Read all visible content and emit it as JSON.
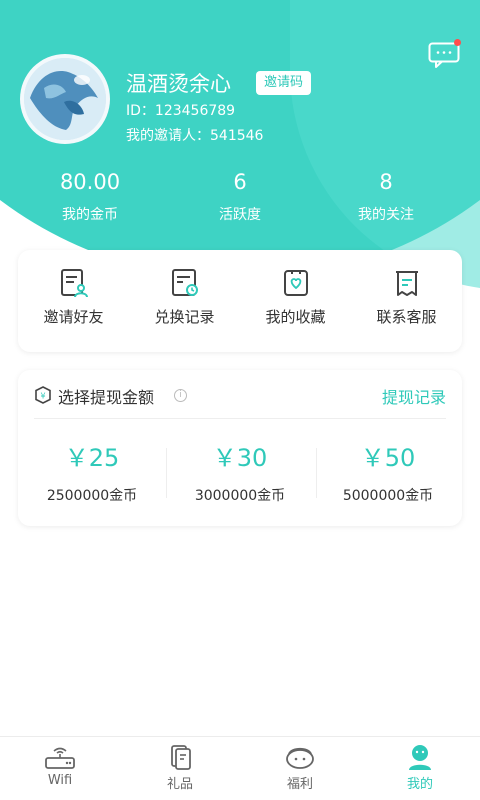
{
  "profile": {
    "username": "温酒烫余心",
    "invite_code_label": "邀请码",
    "id_line": "ID：123456789",
    "inviter_line": "我的邀请人：541546"
  },
  "stats": [
    {
      "value": "80.00",
      "label": "我的金币"
    },
    {
      "value": "6",
      "label": "活跃度"
    },
    {
      "value": "8",
      "label": "我的关注"
    }
  ],
  "menu": [
    {
      "label": "邀请好友",
      "icon": "invite-friend-icon"
    },
    {
      "label": "兑换记录",
      "icon": "exchange-record-icon"
    },
    {
      "label": "我的收藏",
      "icon": "favorites-icon"
    },
    {
      "label": "联系客服",
      "icon": "customer-service-icon"
    }
  ],
  "withdraw": {
    "title": "选择提现金额",
    "record_link": "提现记录",
    "info_glyph": "i",
    "options": [
      {
        "price": "￥25",
        "coins": "2500000金币"
      },
      {
        "price": "￥30",
        "coins": "3000000金币"
      },
      {
        "price": "￥50",
        "coins": "5000000金币"
      }
    ]
  },
  "tabs": [
    {
      "label": "Wifi",
      "icon": "router-icon"
    },
    {
      "label": "礼品",
      "icon": "gift-icon"
    },
    {
      "label": "福利",
      "icon": "welfare-icon"
    },
    {
      "label": "我的",
      "icon": "profile-icon",
      "active": true
    }
  ],
  "colors": {
    "accent": "#2fc9b9",
    "hero": "#3ed3c4",
    "badge": "#ff4d4d"
  }
}
